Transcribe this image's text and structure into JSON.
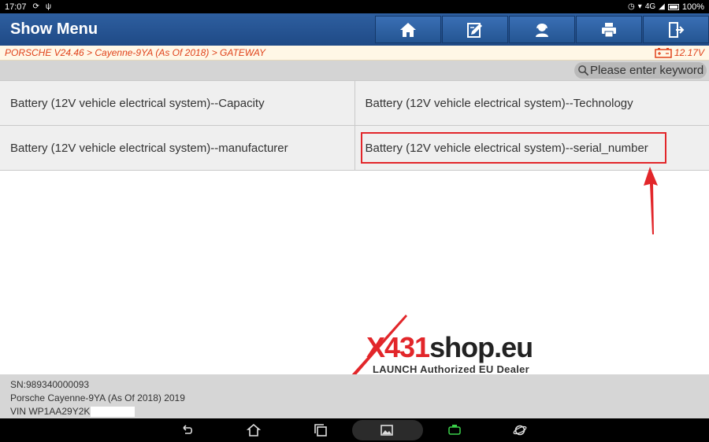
{
  "status_bar": {
    "time": "17:07",
    "signal": "4G",
    "battery": "100%"
  },
  "header": {
    "title": "Show Menu",
    "toolbar": [
      {
        "icon": "home-icon",
        "label": ""
      },
      {
        "icon": "edit-icon",
        "label": ""
      },
      {
        "icon": "support-icon",
        "label": ""
      },
      {
        "icon": "print-icon",
        "label": ""
      },
      {
        "icon": "exit-icon",
        "label": ""
      }
    ]
  },
  "breadcrumb": {
    "path": "PORSCHE V24.46 > Cayenne-9YA (As Of 2018) > GATEWAY",
    "voltage": "12.17V"
  },
  "search": {
    "placeholder": "Please enter keyword"
  },
  "menu": {
    "items": [
      "Battery (12V vehicle electrical system)--Capacity",
      "Battery (12V vehicle electrical system)--Technology",
      "Battery (12V vehicle electrical system)--manufacturer",
      "Battery (12V vehicle electrical system)--serial_number"
    ],
    "highlighted_index": 3
  },
  "watermark": {
    "x": "X",
    "num": "431",
    "shop": "shop.eu",
    "tagline": "LAUNCH Authorized EU Dealer"
  },
  "vehicle_info": {
    "sn": "SN:989340000093",
    "model": "Porsche Cayenne-9YA (As Of 2018) 2019",
    "vin": "VIN WP1AA29Y2K"
  },
  "colors": {
    "header_blue": "#2a5a9a",
    "accent_red": "#e2262a",
    "crumb_orange": "#e0421a"
  }
}
